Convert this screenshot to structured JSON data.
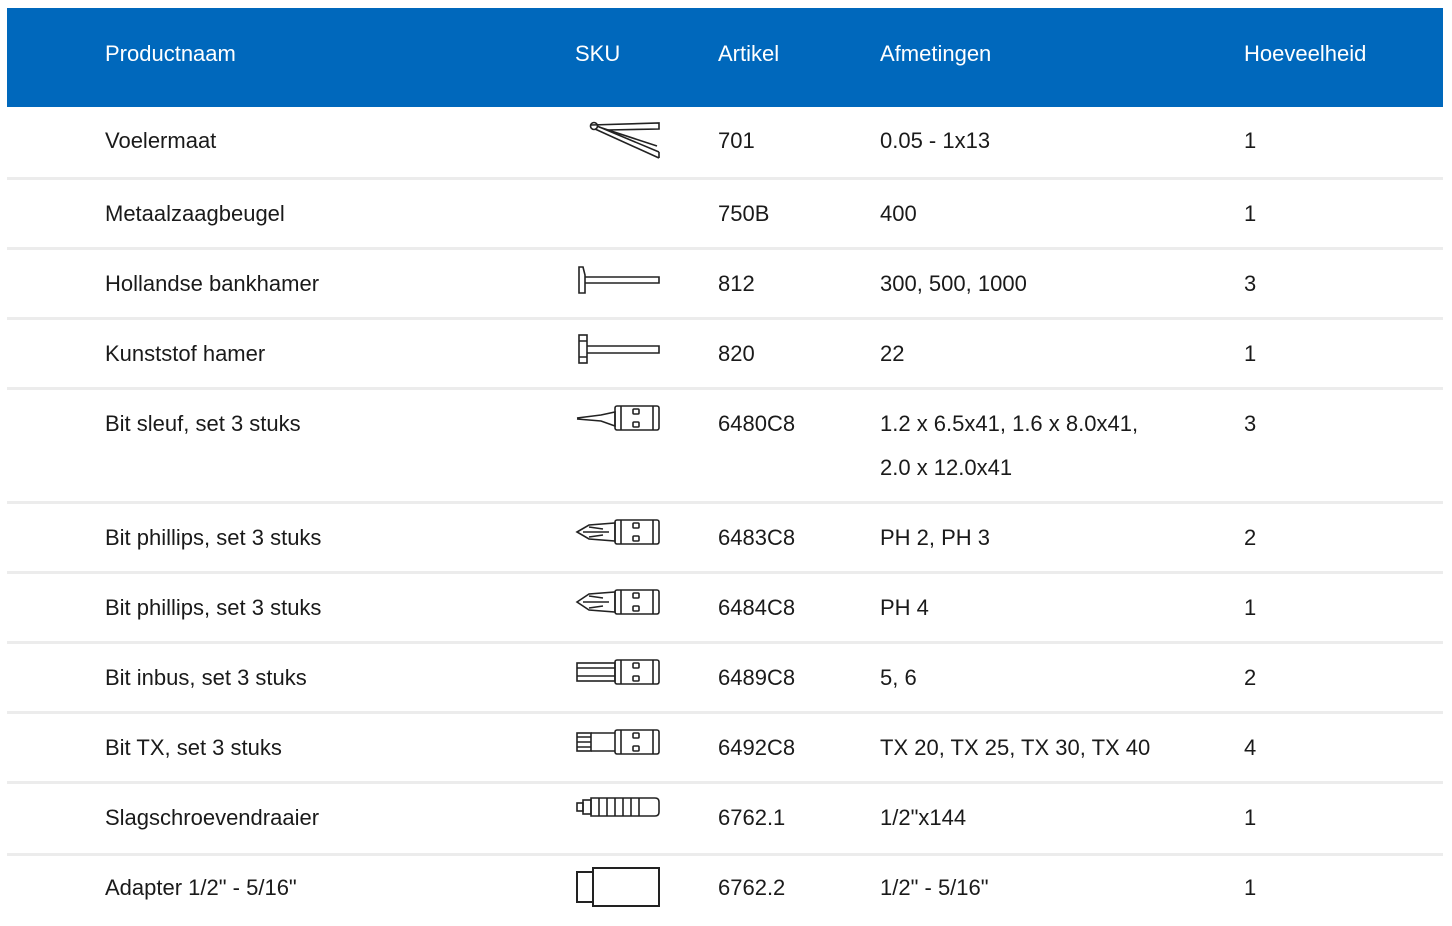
{
  "headers": {
    "name": "Productnaam",
    "sku": "SKU",
    "article": "Artikel",
    "dimensions": "Afmetingen",
    "quantity": "Hoeveelheid"
  },
  "rows": [
    {
      "name": "Voelermaat",
      "icon": "feeler-gauge-icon",
      "article": "701",
      "dimensions": "0.05 - 1x13",
      "quantity": "1"
    },
    {
      "name": "Metaalzaagbeugel",
      "icon": "",
      "article": "750B",
      "dimensions": "400",
      "quantity": "1"
    },
    {
      "name": "Hollandse bankhamer",
      "icon": "bench-hammer-icon",
      "article": "812",
      "dimensions": "300, 500, 1000",
      "quantity": "3"
    },
    {
      "name": "Kunststof hamer",
      "icon": "plastic-hammer-icon",
      "article": "820",
      "dimensions": "22",
      "quantity": "1"
    },
    {
      "name": "Bit sleuf, set 3 stuks",
      "icon": "slotted-bit-icon",
      "article": "6480C8",
      "dimensions": "1.2 x 6.5x41, 1.6 x 8.0x41,",
      "dimensions2": "2.0 x 12.0x41",
      "quantity": "3"
    },
    {
      "name": "Bit phillips, set 3 stuks",
      "icon": "phillips-bit-icon",
      "article": "6483C8",
      "dimensions": "PH 2, PH 3",
      "quantity": "2"
    },
    {
      "name": "Bit phillips, set 3 stuks",
      "icon": "phillips-bit-icon",
      "article": "6484C8",
      "dimensions": "PH 4",
      "quantity": "1"
    },
    {
      "name": "Bit inbus, set 3 stuks",
      "icon": "hex-bit-icon",
      "article": "6489C8",
      "dimensions": "5, 6",
      "quantity": "2"
    },
    {
      "name": "Bit TX, set 3 stuks",
      "icon": "torx-bit-icon",
      "article": "6492C8",
      "dimensions": "TX 20, TX 25, TX 30, TX 40",
      "quantity": "4"
    },
    {
      "name": "Slagschroevendraaier",
      "icon": "impact-driver-icon",
      "article": "6762.1",
      "dimensions": "1/2\"x144",
      "quantity": "1"
    },
    {
      "name": "Adapter 1/2\" - 5/16\"",
      "icon": "adapter-icon",
      "article": "6762.2",
      "dimensions": "1/2\" - 5/16\"",
      "quantity": "1"
    }
  ]
}
